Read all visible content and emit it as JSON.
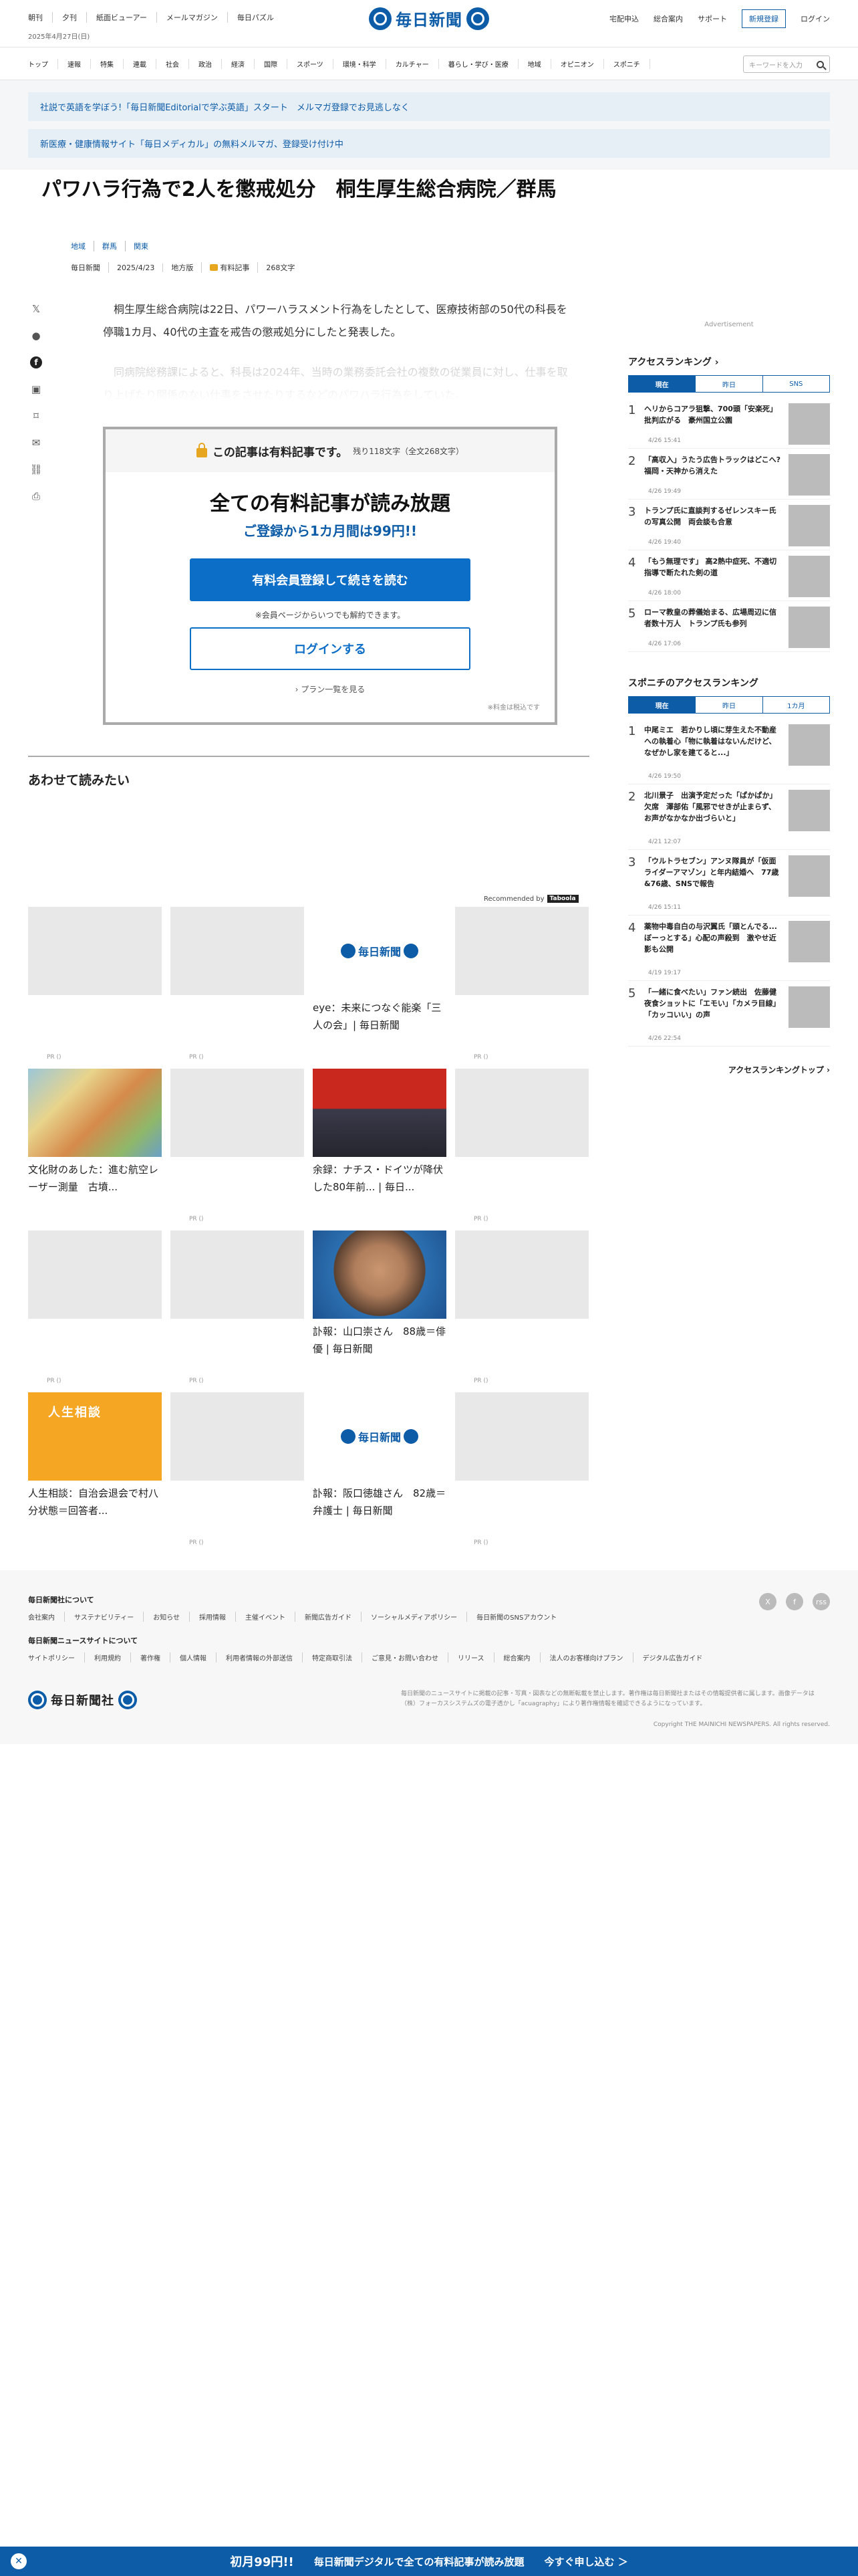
{
  "header": {
    "top_links": [
      "朝刊",
      "夕刊",
      "紙面ビューアー",
      "メールマガジン",
      "毎日パズル"
    ],
    "date": "2025年4月27日(日)",
    "logo": "毎日新聞",
    "right_links": [
      "宅配申込",
      "総合案内",
      "サポート"
    ],
    "register_label": "新規登録",
    "login_label": "ログイン"
  },
  "nav": {
    "items": [
      "トップ",
      "速報",
      "特集",
      "連載",
      "社会",
      "政治",
      "経済",
      "国際",
      "スポーツ",
      "環境・科学",
      "カルチャー",
      "暮らし・学び・医療",
      "地域",
      "オピニオン",
      "スポニチ"
    ],
    "search_placeholder": "キーワードを入力"
  },
  "promos": [
    "社説で英語を学ぼう!「毎日新聞Editorialで学ぶ英語」スタート　メルマガ登録でお見逃しなく",
    "新医療・健康情報サイト「毎日メディカル」の無料メルマガ、登録受け付け中"
  ],
  "article": {
    "title": "パワハラ行為で2人を懲戒処分　桐生厚生総合病院／群馬",
    "tags": [
      "地域",
      "群馬",
      "関東"
    ],
    "meta": [
      "毎日新聞",
      "2025/4/23",
      "地方版",
      "有料記事",
      "268文字"
    ],
    "body": "桐生厚生総合病院は22日、パワーハラスメント行為をしたとして、医療技術部の50代の科長を停職1カ月、40代の主査を戒告の懲戒処分にしたと発表した。",
    "fade_text": "同病院総務課によると、科長は2024年、当時の業務委託会社の複数の従業員に対し、仕事を取り上げたり関係のない仕事をさせたりするなどのパワハラ行為をしていた。"
  },
  "paywall": {
    "head": "この記事は有料記事です。",
    "remaining": "残り118文字（全文268文字）",
    "title": "全ての有料記事が読み放題",
    "subtitle": "ご登録から1カ月間は99円!!",
    "signup_button": "有料会員登録して続きを読む",
    "note": "※会員ページからいつでも解約できます。",
    "login_button": "ログインする",
    "plan_link": "プラン一覧を見る",
    "tax": "※料金は税込です"
  },
  "related": {
    "title": "あわせて読みたい",
    "recommended": "Recommended by",
    "taboola": "Taboola",
    "pr": "PR ()",
    "cards": [
      {
        "title": "",
        "thumb": "gray"
      },
      {
        "title": "",
        "thumb": "gray"
      },
      {
        "title": "eye：未来につなぐ能楽「三人の会」| 毎日新聞",
        "thumb": "logo"
      },
      {
        "title": "",
        "thumb": "gray"
      },
      {
        "title": "文化財のあした：進む航空レーザー測量　古墳...",
        "thumb": "map"
      },
      {
        "title": "",
        "thumb": "gray"
      },
      {
        "title": "余録：ナチス・ドイツが降伏した80年前... | 毎日...",
        "thumb": "flag"
      },
      {
        "title": "",
        "thumb": "gray"
      },
      {
        "title": "",
        "thumb": "gray"
      },
      {
        "title": "",
        "thumb": "gray"
      },
      {
        "title": "訃報：山口崇さん　88歳＝俳優 | 毎日新聞",
        "thumb": "face"
      },
      {
        "title": "",
        "thumb": "gray"
      },
      {
        "title": "人生相談：自治会退会で村八分状態＝回答者...",
        "thumb": "jinsei"
      },
      {
        "title": "",
        "thumb": "gray"
      },
      {
        "title": "訃報：阪口徳雄さん　82歳＝弁護士 | 毎日新聞",
        "thumb": "logo"
      },
      {
        "title": "",
        "thumb": "gray"
      }
    ]
  },
  "sidebar": {
    "ad_label": "Advertisement",
    "ranking_title": "アクセスランキング",
    "ranking_tabs": [
      "現在",
      "昨日",
      "SNS"
    ],
    "ranking": [
      {
        "num": "1",
        "text": "ヘリからコアラ狙撃、700頭「安楽死」 批判広がる　豪州国立公園",
        "time": "4/26 15:41"
      },
      {
        "num": "2",
        "text": "「高収入」うたう広告トラックはどこへ?　福岡・天神から消えた",
        "time": "4/26 19:49"
      },
      {
        "num": "3",
        "text": "トランプ氏に直談判するゼレンスキー氏の写真公開　両会談も合意",
        "time": "4/26 19:40"
      },
      {
        "num": "4",
        "text": "「もう無理です」 高2熱中症死、不適切指導で断たれた剣の道",
        "time": "4/26 18:00"
      },
      {
        "num": "5",
        "text": "ローマ教皇の葬儀始まる、広場周辺に信者数十万人　トランプ氏も参列",
        "time": "4/26 17:06"
      }
    ],
    "sponichi_title": "スポニチのアクセスランキング",
    "sponichi_tabs": [
      "現在",
      "昨日",
      "1カ月"
    ],
    "sponichi": [
      {
        "num": "1",
        "text": "中尾ミエ　若かりし頃に芽生えた不動産への執着心「物に執着はないんだけど、なぜかし家を建てると...」",
        "time": "4/26 19:50"
      },
      {
        "num": "2",
        "text": "北川景子　出演予定だった「ぱかぱか」欠席　澤部佑「風邪でせきが止まらず、お声がなかなか出づらいと」",
        "time": "4/21 12:07"
      },
      {
        "num": "3",
        "text": "「ウルトラセブン」アンヌ隊員が「仮面ライダーアマゾン」と年内結婚へ　77歳&76歳、SNSで報告",
        "time": "4/26 15:11"
      },
      {
        "num": "4",
        "text": "薬物中毒自白の与沢翼氏「頭とんでる...ぼーっとする」心配の声殺到　激やせ近影も公開",
        "time": "4/19 19:17"
      },
      {
        "num": "5",
        "text": "「一緒に食べたい」ファン続出　佐藤健　夜食ショットに「エモい」「カメラ目線」「カッコいい」の声",
        "time": "4/26 22:54"
      }
    ],
    "ranking_more": "アクセスランキングトップ"
  },
  "footer": {
    "about_head": "毎日新聞社について",
    "about_links": [
      "会社案内",
      "サステナビリティー",
      "お知らせ",
      "採用情報",
      "主催イベント",
      "新聞広告ガイド",
      "ソーシャルメディアポリシー",
      "毎日新聞のSNSアカウント"
    ],
    "site_head": "毎日新聞ニュースサイトについて",
    "site_links": [
      "サイトポリシー",
      "利用規約",
      "著作権",
      "個人情報",
      "利用者情報の外部送信",
      "特定商取引法",
      "ご意見・お問い合わせ",
      "リリース",
      "総合案内",
      "法人のお客様向けプラン",
      "デジタル広告ガイド"
    ],
    "social": [
      "X",
      "f",
      "rss"
    ],
    "logo": "毎日新聞社",
    "legal": "毎日新聞のニュースサイトに掲載の記事・写真・図表などの無断転載を禁止します。著作権は毎日新聞社またはその情報提供者に属します。画像データは（株）フォーカスシステムズの電子透かし「acuagraphy」により著作権情報を確認できるようになっています。",
    "copyright": "Copyright THE MAINICHI NEWSPAPERS. All rights reserved."
  },
  "bottom_banner": {
    "lead": "初月99円!!",
    "text": "毎日新聞デジタルで全ての有料記事が読み放題",
    "cta": "今すぐ申し込む ＞"
  },
  "colors": {
    "brand": "#0d5ca8",
    "lock": "#e6a620"
  }
}
